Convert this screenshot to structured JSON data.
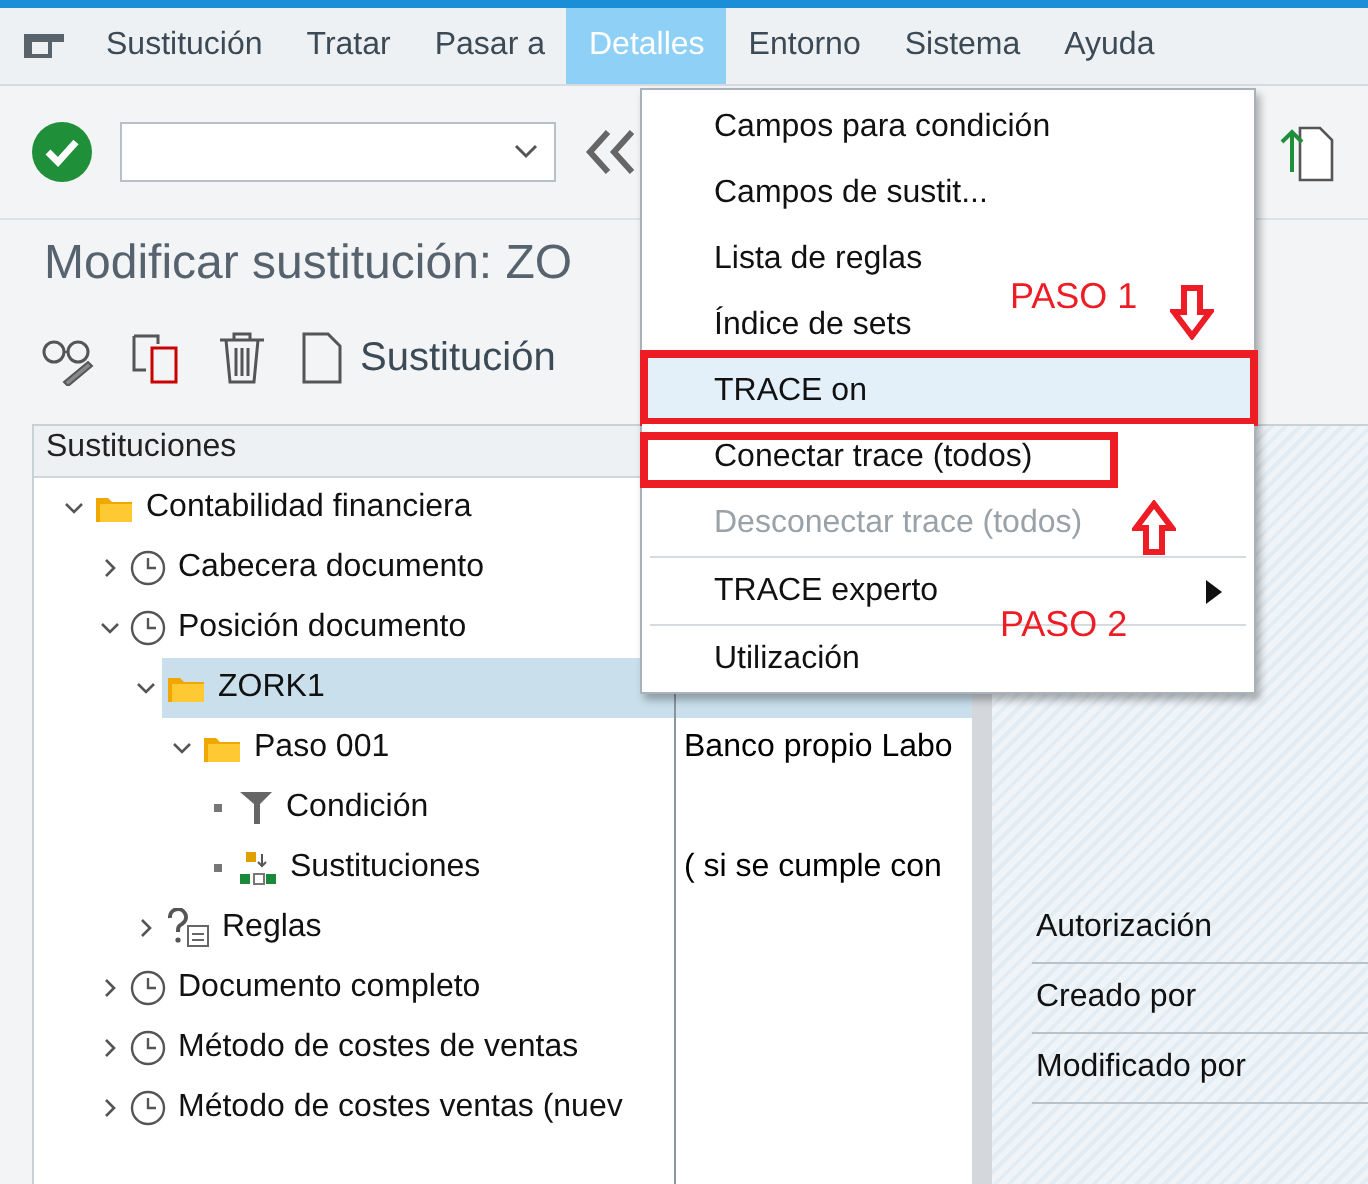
{
  "menu_bar": [
    {
      "label": "Sustitución",
      "selected": false
    },
    {
      "label": "Tratar",
      "selected": false
    },
    {
      "label": "Pasar a",
      "selected": false
    },
    {
      "label": "Detalles",
      "selected": true
    },
    {
      "label": "Entorno",
      "selected": false
    },
    {
      "label": "Sistema",
      "selected": false
    },
    {
      "label": "Ayuda",
      "selected": false
    }
  ],
  "title": "Modificar sustitución: ZO",
  "app_toolbar": {
    "button": "Sustitución"
  },
  "tree": {
    "header": "Sustituciones",
    "nodes": [
      {
        "label": "Contabilidad financiera",
        "kind": "folder",
        "expanded": true,
        "selected": false,
        "children": [
          {
            "label": "Cabecera documento",
            "kind": "event",
            "expanded": false,
            "selected": false
          },
          {
            "label": "Posición documento",
            "kind": "event",
            "expanded": true,
            "selected": false,
            "children": [
              {
                "label": "ZORK1",
                "kind": "folder",
                "expanded": true,
                "selected": true,
                "children": [
                  {
                    "label": "Paso 001",
                    "kind": "folder",
                    "expanded": true,
                    "selected": false,
                    "children": [
                      {
                        "label": "Condición",
                        "kind": "filter",
                        "selected": false
                      },
                      {
                        "label": "Sustituciones",
                        "kind": "substitution",
                        "selected": false
                      }
                    ]
                  }
                ]
              },
              {
                "label": "Reglas",
                "kind": "rules",
                "expanded": false,
                "selected": false
              }
            ]
          },
          {
            "label": "Documento completo",
            "kind": "event",
            "expanded": false,
            "selected": false
          },
          {
            "label": "Método de costes de ventas",
            "kind": "event",
            "expanded": false,
            "selected": false
          },
          {
            "label": "Método de costes ventas (nuev",
            "kind": "event",
            "expanded": false,
            "selected": false
          }
        ]
      }
    ]
  },
  "detail_column": [
    {
      "selected": true
    },
    {
      "text": "Banco propio Labo",
      "selected": false
    },
    {
      "selected": false
    },
    {
      "text": "( si se cumple con",
      "selected": false
    }
  ],
  "attributes": [
    "Autorización",
    "Creado por",
    "Modificado por"
  ],
  "dropdown": {
    "groups": [
      [
        {
          "label": "Campos para condición",
          "selected": false,
          "disabled": false
        },
        {
          "label": "Campos de sustit...",
          "selected": false,
          "disabled": false
        },
        {
          "label": "Lista de reglas",
          "selected": false,
          "disabled": false
        },
        {
          "label": "Índice de sets",
          "selected": false,
          "disabled": false
        }
      ],
      [
        {
          "label": "TRACE on",
          "selected": true,
          "disabled": false
        },
        {
          "label": "Conectar trace (todos)",
          "selected": false,
          "disabled": false
        },
        {
          "label": "Desconectar trace (todos)",
          "selected": false,
          "disabled": true
        }
      ],
      [
        {
          "label": "TRACE experto",
          "selected": false,
          "disabled": false,
          "submenu": true
        }
      ],
      [
        {
          "label": "Utilización",
          "selected": false,
          "disabled": false
        }
      ]
    ]
  },
  "annotations": [
    {
      "text": "PASO 1"
    },
    {
      "text": "PASO 2"
    }
  ]
}
